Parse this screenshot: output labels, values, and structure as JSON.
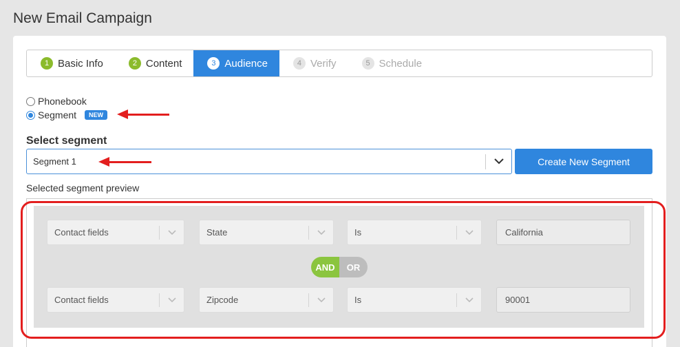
{
  "page": {
    "title": "New Email Campaign"
  },
  "wizard": {
    "steps": [
      {
        "num": "1",
        "label": "Basic Info"
      },
      {
        "num": "2",
        "label": "Content"
      },
      {
        "num": "3",
        "label": "Audience"
      },
      {
        "num": "4",
        "label": "Verify"
      },
      {
        "num": "5",
        "label": "Schedule"
      }
    ]
  },
  "audience": {
    "options": [
      {
        "label": "Phonebook",
        "checked": false
      },
      {
        "label": "Segment",
        "checked": true,
        "badge": "NEW"
      }
    ]
  },
  "segment": {
    "label": "Select segment",
    "selected": "Segment 1",
    "create_button": "Create New Segment"
  },
  "preview": {
    "label": "Selected segment preview",
    "rules": [
      {
        "field_type": "Contact fields",
        "field": "State",
        "operator": "Is",
        "value": "California"
      },
      {
        "field_type": "Contact fields",
        "field": "Zipcode",
        "operator": "Is",
        "value": "90001"
      }
    ],
    "logic": {
      "and": "AND",
      "or": "OR",
      "selected": "AND"
    }
  },
  "colors": {
    "primary": "#2f86de",
    "done": "#8bbb2c",
    "annotation": "#e31e1e"
  }
}
